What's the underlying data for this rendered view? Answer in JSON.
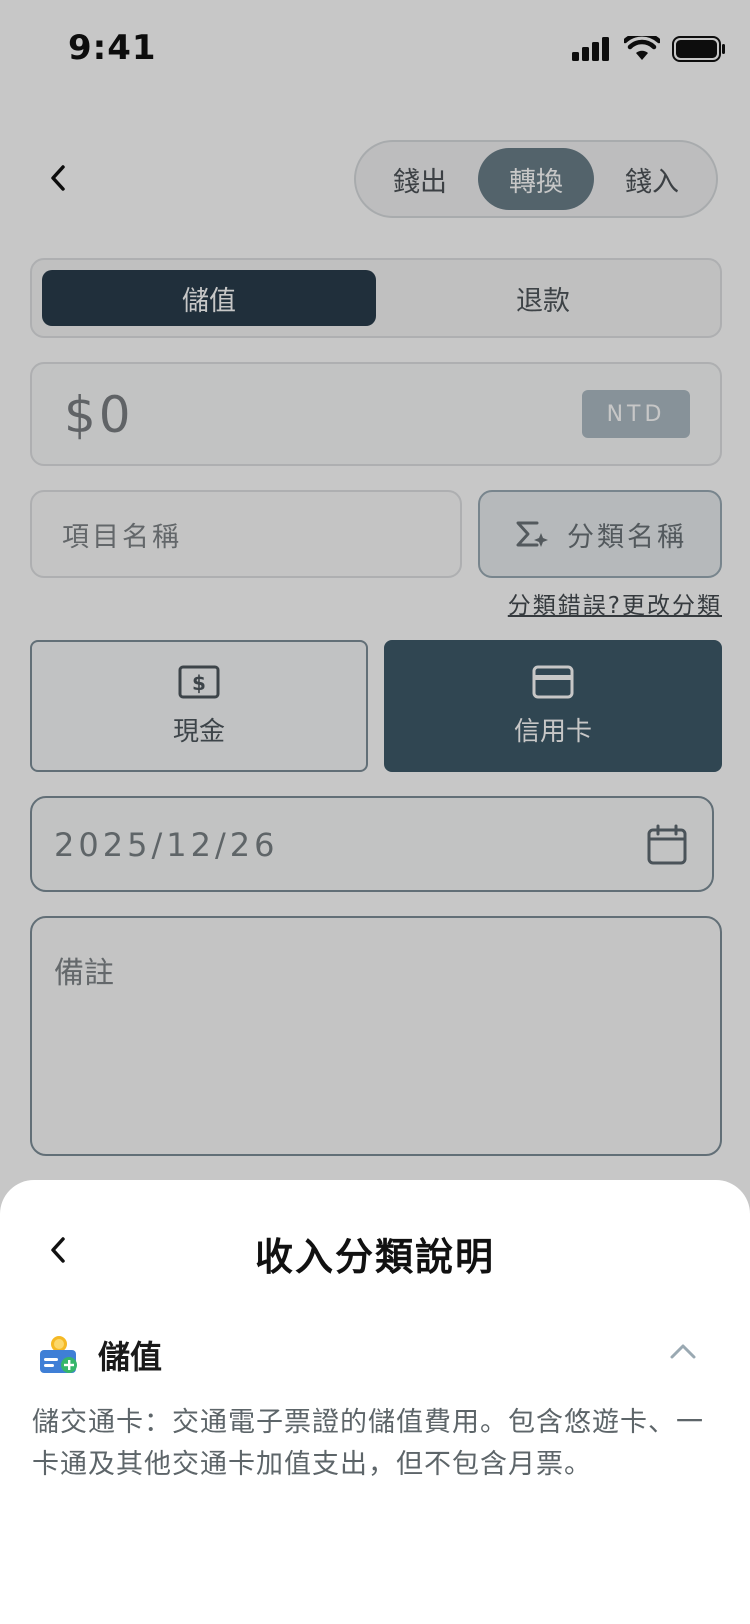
{
  "status_bar": {
    "time": "9:41"
  },
  "type_switch": {
    "options": [
      "錢出",
      "轉換",
      "錢入"
    ],
    "selected": "轉換"
  },
  "sub_switch": {
    "options": [
      "儲值",
      "退款"
    ],
    "selected": "儲值"
  },
  "amount": {
    "value": "$0",
    "currency": "NTD"
  },
  "item_name": {
    "placeholder": "項目名稱"
  },
  "category": {
    "label": "分類名稱",
    "change_link": "分類錯誤?更改分類"
  },
  "payment": {
    "cash": "現金",
    "credit": "信用卡",
    "selected": "信用卡"
  },
  "date": {
    "value": "2025/12/26"
  },
  "note": {
    "placeholder": "備註"
  },
  "sheet": {
    "title": "收入分類說明",
    "category": {
      "label": "儲值",
      "description": "儲交通卡：交通電子票證的儲值費用。包含悠遊卡、一卡通及其他交通卡加值支出，但不包含月票。"
    }
  },
  "colors": {
    "accent_dark": "#2a3d4c",
    "accent_mid": "#6b7f8a",
    "selected_card": "#3e5a6a",
    "currency_badge": "#aebcc4"
  }
}
